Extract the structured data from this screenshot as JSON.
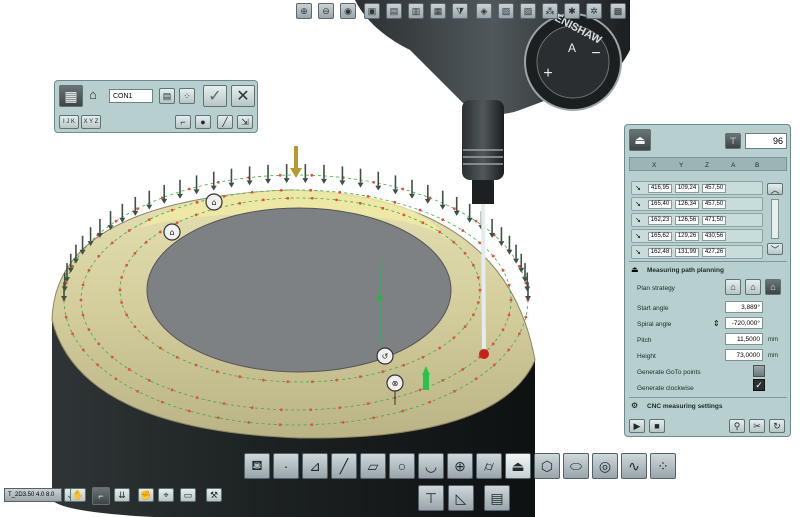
{
  "probe": {
    "brand_text": "RENISHAW",
    "dial_symbols": {
      "plus": "+",
      "minus": "−",
      "a": "A"
    }
  },
  "top_toolbar": {
    "buttons": [
      {
        "name": "zoom-in-icon",
        "glyph": "⊕"
      },
      {
        "name": "zoom-out-icon",
        "glyph": "⊖"
      },
      {
        "name": "eye-icon",
        "glyph": "◉"
      },
      {
        "name": "view-icon",
        "glyph": "▣"
      },
      {
        "name": "view-icon",
        "glyph": "▤"
      },
      {
        "name": "view-icon",
        "glyph": "▥"
      },
      {
        "name": "view-icon",
        "glyph": "▦"
      },
      {
        "name": "filter-icon",
        "glyph": "⧩"
      },
      {
        "name": "cube-icon",
        "glyph": "◈"
      },
      {
        "name": "view-icon",
        "glyph": "▧"
      },
      {
        "name": "view-icon",
        "glyph": "▨"
      },
      {
        "name": "network-icon",
        "glyph": "⁂"
      },
      {
        "name": "network-icon",
        "glyph": "✱"
      },
      {
        "name": "network-icon",
        "glyph": "✲"
      },
      {
        "name": "view-icon",
        "glyph": "▩"
      }
    ]
  },
  "feature_panel": {
    "name_value": "CON1",
    "axis_buttons": [
      "I J K",
      "X Y Z"
    ]
  },
  "right_panel": {
    "probe_count": "96",
    "headers": [
      "X",
      "Y",
      "Z",
      "A",
      "B"
    ],
    "rows": [
      {
        "values": [
          "416,95",
          "109,24",
          "457,50"
        ]
      },
      {
        "values": [
          "165,40",
          "126,34",
          "457,50"
        ]
      },
      {
        "values": [
          "162,23",
          "126,56",
          "471,50"
        ]
      },
      {
        "values": [
          "165,62",
          "129,26",
          "430,56"
        ]
      },
      {
        "values": [
          "162,48",
          "131,99",
          "427,26"
        ]
      }
    ],
    "section_title": "Measuring path planning",
    "plan_strategy_label": "Plan strategy",
    "start_angle_label": "Start angle",
    "start_angle_value": "3,889°",
    "spiral_angle_label": "Spiral angle",
    "spiral_angle_value": "-720,000°",
    "pitch_label": "Pitch",
    "pitch_value": "11,5000",
    "pitch_unit": "mm",
    "height_label": "Height",
    "height_value": "73,0000",
    "height_unit": "mm",
    "goto_label": "Generate GoTo points",
    "clockwise_label": "Generate clockwise",
    "cnc_label": "CNC measuring settings"
  },
  "bottom_left": {
    "program_select": "T_2D3.50 4.0 8.0"
  },
  "tool_palette": [
    {
      "name": "probe-tip-icon",
      "glyph": "⛾"
    },
    {
      "name": "point-icon",
      "glyph": "·"
    },
    {
      "name": "surface-point-icon",
      "glyph": "⊿"
    },
    {
      "name": "line-icon",
      "glyph": "╱"
    },
    {
      "name": "plane-icon",
      "glyph": "▱"
    },
    {
      "name": "circle-icon",
      "glyph": "○"
    },
    {
      "name": "arc-icon",
      "glyph": "◡"
    },
    {
      "name": "sphere-icon",
      "glyph": "⊕"
    },
    {
      "name": "cylinder-icon",
      "glyph": "⌭"
    },
    {
      "name": "cone-icon",
      "glyph": "⏏"
    },
    {
      "name": "hexagon-icon",
      "glyph": "⬡"
    },
    {
      "name": "slot-icon",
      "glyph": "⬭"
    },
    {
      "name": "torus-icon",
      "glyph": "◎"
    },
    {
      "name": "curve-icon",
      "glyph": "∿"
    },
    {
      "name": "point-cloud-icon",
      "glyph": "⁘"
    }
  ]
}
